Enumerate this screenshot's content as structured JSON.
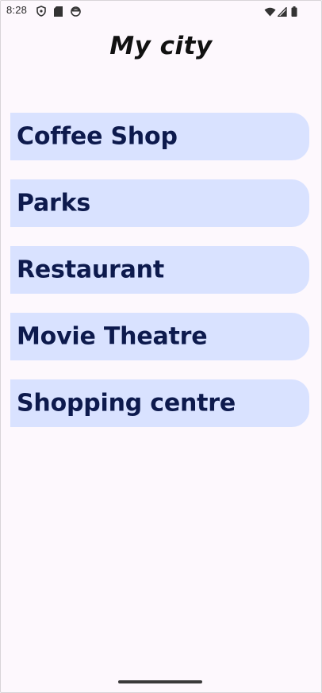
{
  "status_bar": {
    "time": "8:28",
    "left_icons": [
      "shield-icon",
      "sd-card-icon",
      "face-icon"
    ],
    "right_icons": [
      "wifi-icon",
      "signal-icon",
      "battery-icon"
    ]
  },
  "app": {
    "title": "My city"
  },
  "categories": [
    {
      "label": "Coffee Shop"
    },
    {
      "label": "Parks"
    },
    {
      "label": "Restaurant"
    },
    {
      "label": "Movie Theatre"
    },
    {
      "label": "Shopping centre"
    }
  ],
  "colors": {
    "background": "#fdf8fd",
    "card": "#d9e2ff",
    "card_text": "#0d1a4d",
    "title_text": "#111111"
  }
}
